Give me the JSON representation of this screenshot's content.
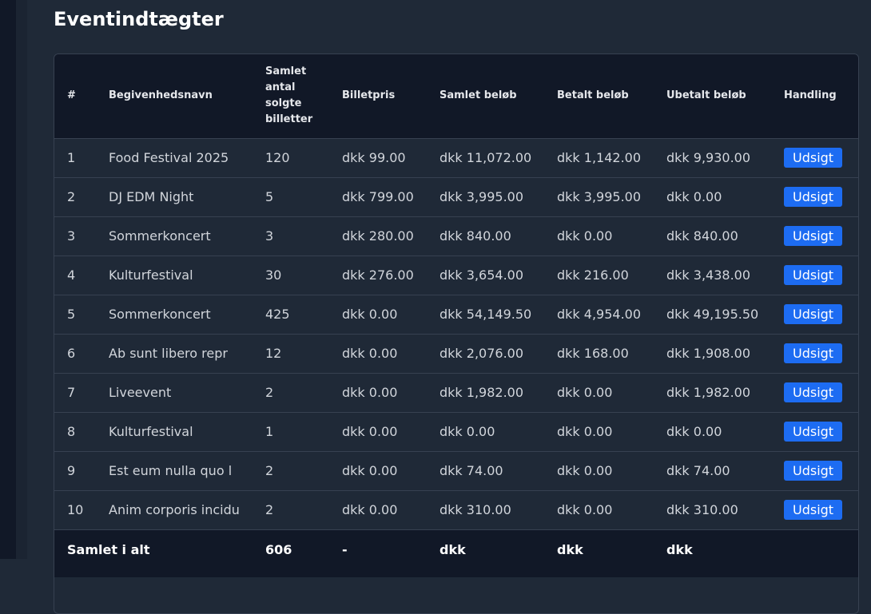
{
  "page": {
    "title": "Eventindtægter"
  },
  "table": {
    "headers": {
      "index": "#",
      "name": "Begivenhedsnavn",
      "tickets": "Samlet antal solgte billetter",
      "price": "Billetpris",
      "total": "Samlet beløb",
      "paid": "Betalt beløb",
      "unpaid": "Ubetalt beløb",
      "action": "Handling"
    },
    "rows": [
      {
        "index": "1",
        "name": "Food Festival 2025",
        "tickets": "120",
        "price": "dkk 99.00",
        "total": "dkk 11,072.00",
        "paid": "dkk 1,142.00",
        "unpaid": "dkk 9,930.00",
        "action": "Udsigt"
      },
      {
        "index": "2",
        "name": "DJ EDM Night",
        "tickets": "5",
        "price": "dkk 799.00",
        "total": "dkk 3,995.00",
        "paid": "dkk 3,995.00",
        "unpaid": "dkk 0.00",
        "action": "Udsigt"
      },
      {
        "index": "3",
        "name": "Sommerkoncert",
        "tickets": "3",
        "price": "dkk 280.00",
        "total": "dkk 840.00",
        "paid": "dkk 0.00",
        "unpaid": "dkk 840.00",
        "action": "Udsigt"
      },
      {
        "index": "4",
        "name": "Kulturfestival",
        "tickets": "30",
        "price": "dkk 276.00",
        "total": "dkk 3,654.00",
        "paid": "dkk 216.00",
        "unpaid": "dkk 3,438.00",
        "action": "Udsigt"
      },
      {
        "index": "5",
        "name": "Sommerkoncert",
        "tickets": "425",
        "price": "dkk 0.00",
        "total": "dkk 54,149.50",
        "paid": "dkk 4,954.00",
        "unpaid": "dkk 49,195.50",
        "action": "Udsigt"
      },
      {
        "index": "6",
        "name": "Ab sunt libero repr",
        "tickets": "12",
        "price": "dkk 0.00",
        "total": "dkk 2,076.00",
        "paid": "dkk 168.00",
        "unpaid": "dkk 1,908.00",
        "action": "Udsigt"
      },
      {
        "index": "7",
        "name": "Liveevent",
        "tickets": "2",
        "price": "dkk 0.00",
        "total": "dkk 1,982.00",
        "paid": "dkk 0.00",
        "unpaid": "dkk 1,982.00",
        "action": "Udsigt"
      },
      {
        "index": "8",
        "name": "Kulturfestival",
        "tickets": "1",
        "price": "dkk 0.00",
        "total": "dkk 0.00",
        "paid": "dkk 0.00",
        "unpaid": "dkk 0.00",
        "action": "Udsigt"
      },
      {
        "index": "9",
        "name": "Est eum nulla quo l",
        "tickets": "2",
        "price": "dkk 0.00",
        "total": "dkk 74.00",
        "paid": "dkk 0.00",
        "unpaid": "dkk 74.00",
        "action": "Udsigt"
      },
      {
        "index": "10",
        "name": "Anim corporis incidu",
        "tickets": "2",
        "price": "dkk 0.00",
        "total": "dkk 310.00",
        "paid": "dkk 0.00",
        "unpaid": "dkk 310.00",
        "action": "Udsigt"
      }
    ],
    "footer": {
      "label": "Samlet i alt",
      "tickets": "606",
      "price": "-",
      "total": "dkk",
      "paid": "dkk",
      "unpaid": "dkk"
    }
  },
  "colors": {
    "background": "#1f2937",
    "header_bg": "#111827",
    "button": "#1d6cf2",
    "border": "#374151"
  }
}
